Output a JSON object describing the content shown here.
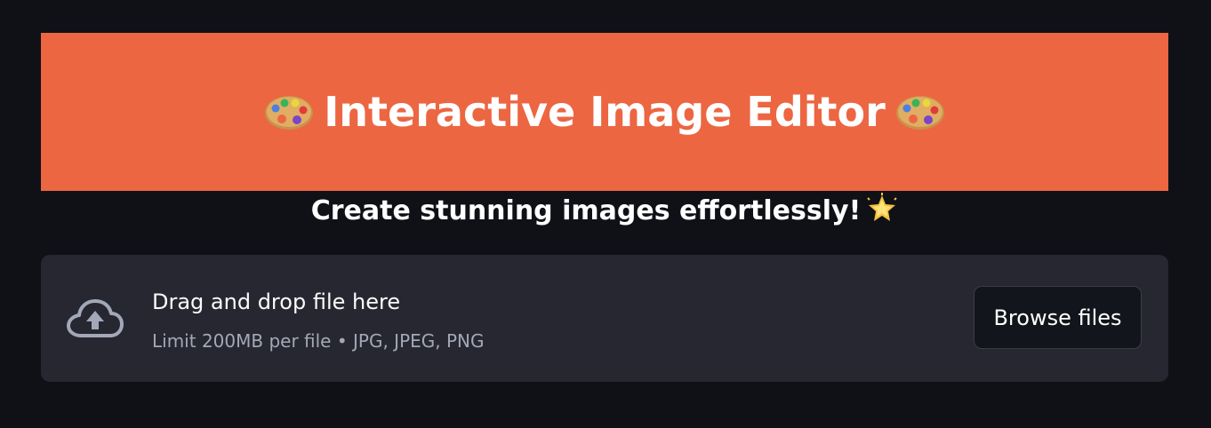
{
  "header": {
    "title": "Interactive Image Editor",
    "left_icon": "artist-palette-icon",
    "right_icon": "artist-palette-icon",
    "background_color": "#ec6642"
  },
  "subtitle": {
    "text": "Create stunning images effortlessly!",
    "icon": "glowing-star-icon"
  },
  "uploader": {
    "icon": "cloud-upload-icon",
    "drop_label": "Drag and drop file here",
    "limit_label": "Limit 200MB per file • JPG, JPEG, PNG",
    "browse_label": "Browse files"
  },
  "theme": {
    "page_background": "#0f1117",
    "uploader_background": "#262730",
    "button_background": "#13151c"
  }
}
